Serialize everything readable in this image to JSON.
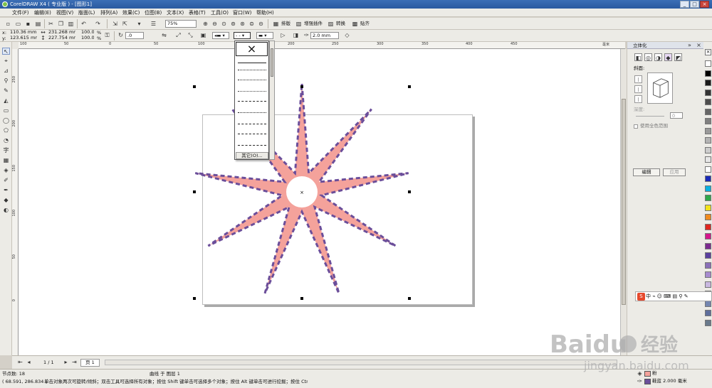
{
  "window": {
    "title": "CorelDRAW X4 ( 专业版 ) - [图形1]",
    "minimize": "_",
    "maximize": "□",
    "close": "×"
  },
  "menu": [
    "文件(F)",
    "编辑(E)",
    "视图(V)",
    "版面(L)",
    "排列(A)",
    "效果(C)",
    "位图(B)",
    "文本(X)",
    "表格(T)",
    "工具(O)",
    "窗口(W)",
    "帮助(H)"
  ],
  "toolbar1": {
    "zoom_value": "75%",
    "layout_label": "排版",
    "plugin_label": "增强插件",
    "convert_label": "转换",
    "paste_label": "贴齐"
  },
  "propbar": {
    "x_label": "x:",
    "x_value": "110.36 mm",
    "y_label": "y:",
    "y_value": "123.615 mm",
    "w_value": "231.268 mm",
    "h_value": "227.754 mm",
    "scale_x": "100.0",
    "scale_y": "100.0",
    "pct": "%",
    "angle": ".0",
    "outline_width": "2.0 mm"
  },
  "dropdown": {
    "none_symbol": "×",
    "more_label": "其它(O)..."
  },
  "ruler": {
    "h_ticks": [
      "100",
      "50",
      "0",
      "50",
      "100",
      "150",
      "200",
      "250",
      "300",
      "350",
      "400",
      "450"
    ],
    "v_ticks": [
      "250",
      "200",
      "150",
      "100",
      "50",
      "0"
    ],
    "units": "毫米"
  },
  "docker": {
    "title": "立体化",
    "bevel_label": "斜面:",
    "depth_label": "深度:",
    "depth_value": "0",
    "use_full_color": "使用全色范围",
    "edit_button": "编辑",
    "apply_button": "应用"
  },
  "palette": [
    "#ffffff",
    "#000000",
    "#1a1a1a",
    "#333333",
    "#4d4d4d",
    "#666666",
    "#808080",
    "#999999",
    "#b3b3b3",
    "#cccccc",
    "#e6e6e6",
    "#ffffff",
    "#1b2ab8",
    "#0bb0e0",
    "#2ea84a",
    "#f2e21b",
    "#f08a1d",
    "#e0261f",
    "#d4168c",
    "#7b2a8f",
    "#5a3f9e",
    "#8a6fb8",
    "#a78bcf",
    "#c9b8e0",
    "#8b8fa8",
    "#7486b0",
    "#5e6e9c",
    "#6a7a8c"
  ],
  "pagebar": {
    "page_counter": "1 / 1",
    "page_tab": "页 1"
  },
  "status": {
    "nodes": "节点数: 18",
    "object_info": "曲线 于 图层 1",
    "coords": "( 68.591, 286.834 )",
    "hint": "单击对象两次可旋转/倾斜；双击工具可选择所有对象；按住 Shift 键单击可选择多个对象；按住 Alt 键单击可进行挖掘；按住 Ctrl 并单...",
    "fill_color_label": "粉",
    "outline_label": "鞋蓝  2.000 毫米"
  },
  "ime": {
    "badge": "S",
    "text": "中 ⌁ ☺ ⌨ ▤ ⚲ ✎"
  },
  "colors": {
    "star_fill": "#f4a29b",
    "star_outline": "#6b4e9a",
    "fill_chip": "#f4a29b",
    "outline_chip": "#6b4e9a",
    "titlebar": "#2a5aa0"
  },
  "watermark": {
    "brand": "Baidu",
    "label": "经验",
    "url": "jingyan.baidu.com"
  }
}
